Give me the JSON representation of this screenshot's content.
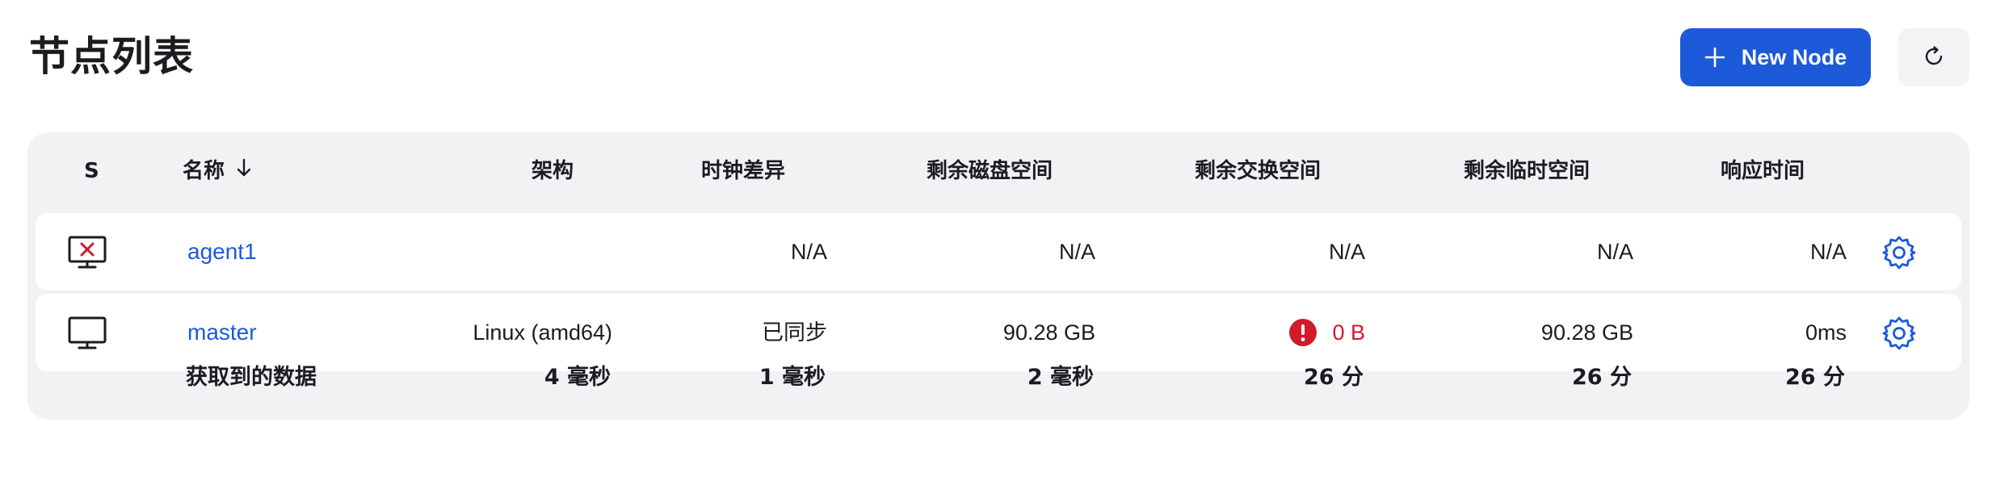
{
  "header": {
    "title": "节点列表",
    "new_node_label": "New Node"
  },
  "table": {
    "columns": {
      "status": "S",
      "name": "名称",
      "arch": "架构",
      "clock": "时钟差异",
      "disk": "剩余磁盘空间",
      "swap": "剩余交换空间",
      "temp": "剩余临时空间",
      "response": "响应时间"
    },
    "rows": [
      {
        "status": "offline",
        "name": "agent1",
        "arch": "",
        "clock": "N/A",
        "disk": "N/A",
        "swap": "N/A",
        "temp": "N/A",
        "response": "N/A"
      },
      {
        "status": "online",
        "name": "master",
        "arch": "Linux (amd64)",
        "clock": "已同步",
        "disk": "90.28 GB",
        "swap": "0 B",
        "temp": "90.28 GB",
        "response": "0ms"
      }
    ],
    "fetch_row": {
      "label": "获取到的数据",
      "arch": "4 毫秒",
      "clock": "1 毫秒",
      "disk": "2 毫秒",
      "swap": "26 分",
      "temp": "26 分",
      "response": "26 分"
    }
  },
  "colors": {
    "accent": "#1d5ad9",
    "danger": "#d11a2a",
    "card_bg": "#f2f2f5"
  },
  "icons": [
    "plus-icon",
    "refresh-icon",
    "sort-down-icon",
    "computer-offline-icon",
    "computer-icon",
    "gear-icon",
    "warning-icon"
  ]
}
